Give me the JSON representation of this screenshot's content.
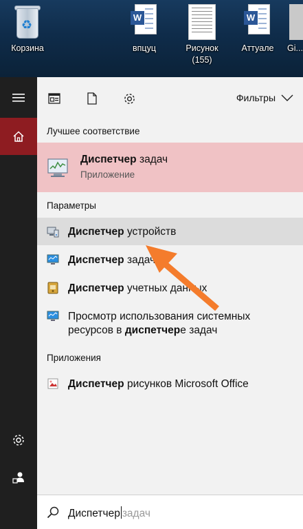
{
  "desktop": {
    "icons": [
      {
        "label": "Корзина",
        "icon": "recycle-bin-icon"
      },
      {
        "label": "впцуц",
        "icon": "word-document-icon"
      },
      {
        "label": "Рисунок (155)",
        "icon": "image-file-icon"
      },
      {
        "label": "Аттуале",
        "icon": "word-document-icon"
      },
      {
        "label": "Gi...",
        "icon": "app-icon"
      }
    ]
  },
  "rail": {
    "items": [
      "hamburger-menu-icon",
      "home-icon",
      "settings-gear-icon",
      "user-account-icon"
    ]
  },
  "toolbar": {
    "icons": [
      "documents-icon",
      "file-icon",
      "settings-gear-icon"
    ],
    "filters_label": "Фильтры"
  },
  "best_match": {
    "section_label": "Лучшее соответствие",
    "title_bold": "Диспетчер",
    "title_rest": " задач",
    "subtitle": "Приложение"
  },
  "settings": {
    "section_label": "Параметры",
    "items": [
      {
        "bold": "Диспетчер",
        "rest": " устройств",
        "icon": "device-manager-icon"
      },
      {
        "bold": "Диспетчер",
        "rest": " задач",
        "icon": "monitor-icon"
      },
      {
        "bold": "Диспетчер",
        "rest": " учетных данных",
        "icon": "credential-manager-icon"
      },
      {
        "pre": "Просмотр использования системных ресурсов в ",
        "bold": "диспетчер",
        "rest": "е задач",
        "icon": "monitor-icon"
      }
    ]
  },
  "apps": {
    "section_label": "Приложения",
    "items": [
      {
        "bold": "Диспетчер",
        "rest": " рисунков Microsoft Office",
        "icon": "picture-manager-icon"
      }
    ]
  },
  "search": {
    "typed": "Диспетчер",
    "suggestion": "задач"
  },
  "colors": {
    "accent": "#8e1c21",
    "best_match_bg": "#f0c2c5",
    "arrow": "#f47c2c"
  }
}
